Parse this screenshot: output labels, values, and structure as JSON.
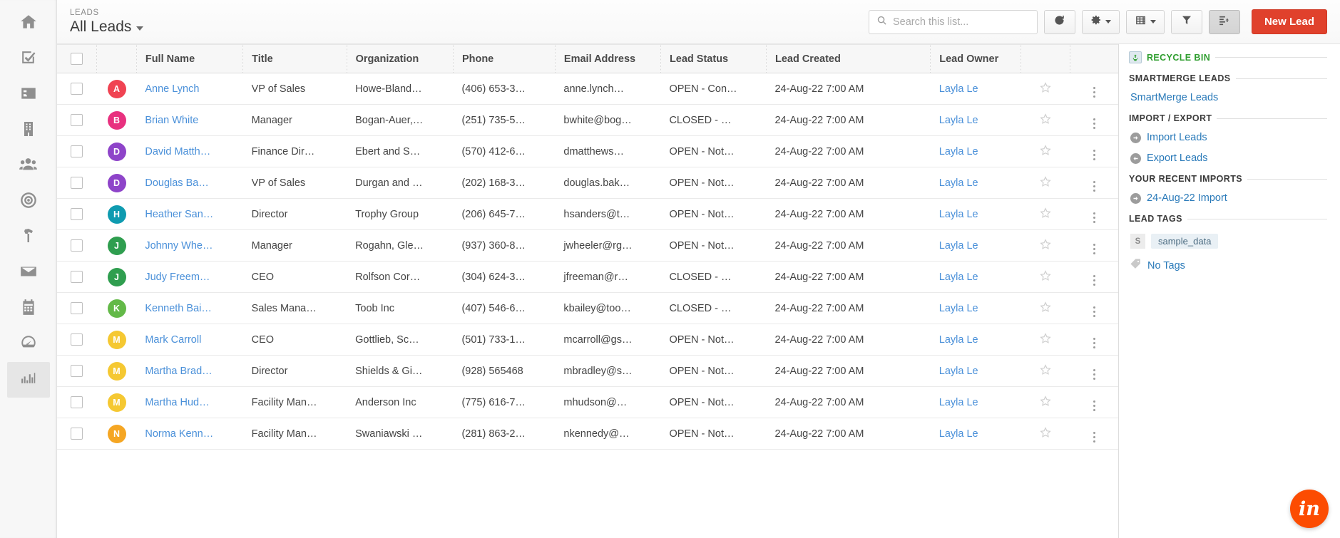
{
  "nav": {
    "items": [
      {
        "name": "home",
        "icon": "home-icon"
      },
      {
        "name": "tasks",
        "icon": "task-check-icon"
      },
      {
        "name": "contacts",
        "icon": "contact-card-icon"
      },
      {
        "name": "companies",
        "icon": "building-icon"
      },
      {
        "name": "leads",
        "icon": "users-icon"
      },
      {
        "name": "targets",
        "icon": "target-icon"
      },
      {
        "name": "projects",
        "icon": "hammer-icon"
      },
      {
        "name": "mail",
        "icon": "envelope-icon"
      },
      {
        "name": "calendar",
        "icon": "calendar-icon"
      },
      {
        "name": "dashboard",
        "icon": "gauge-icon"
      },
      {
        "name": "reports",
        "icon": "bar-chart-icon"
      }
    ],
    "active_index": 10
  },
  "header": {
    "eyebrow": "LEADS",
    "title": "All Leads",
    "search_placeholder": "Search this list...",
    "search_value": "",
    "refresh_label": "",
    "settings_label": "",
    "columns_label": "",
    "filter_label": "",
    "sort_label": "",
    "new_lead_label": "New Lead"
  },
  "table": {
    "columns": [
      "Full Name",
      "Title",
      "Organization",
      "Phone",
      "Email Address",
      "Lead Status",
      "Lead Created",
      "Lead Owner"
    ],
    "rows": [
      {
        "initial": "A",
        "color": "#f04352",
        "name": "Anne Lynch",
        "title": "VP of Sales",
        "org": "Howe-Bland…",
        "phone": "(406) 653-3…",
        "email": "anne.lynch…",
        "status": "OPEN - Con…",
        "created": "24-Aug-22 7:00 AM",
        "owner": "Layla Le"
      },
      {
        "initial": "B",
        "color": "#e8317f",
        "name": "Brian White",
        "title": "Manager",
        "org": "Bogan-Auer,…",
        "phone": "(251) 735-5…",
        "email": "bwhite@bog…",
        "status": "CLOSED - …",
        "created": "24-Aug-22 7:00 AM",
        "owner": "Layla Le"
      },
      {
        "initial": "D",
        "color": "#8e44c9",
        "name": "David Matth…",
        "title": "Finance Dir…",
        "org": "Ebert and S…",
        "phone": "(570) 412-6…",
        "email": "dmatthews…",
        "status": "OPEN - Not…",
        "created": "24-Aug-22 7:00 AM",
        "owner": "Layla Le"
      },
      {
        "initial": "D",
        "color": "#8e44c9",
        "name": "Douglas Ba…",
        "title": "VP of Sales",
        "org": "Durgan and …",
        "phone": "(202) 168-3…",
        "email": "douglas.bak…",
        "status": "OPEN - Not…",
        "created": "24-Aug-22 7:00 AM",
        "owner": "Layla Le"
      },
      {
        "initial": "H",
        "color": "#0f9bb0",
        "name": "Heather San…",
        "title": "Director",
        "org": "Trophy Group",
        "phone": "(206) 645-7…",
        "email": "hsanders@t…",
        "status": "OPEN - Not…",
        "created": "24-Aug-22 7:00 AM",
        "owner": "Layla Le"
      },
      {
        "initial": "J",
        "color": "#2f9e4f",
        "name": "Johnny Whe…",
        "title": "Manager",
        "org": "Rogahn, Gle…",
        "phone": "(937) 360-8…",
        "email": "jwheeler@rg…",
        "status": "OPEN - Not…",
        "created": "24-Aug-22 7:00 AM",
        "owner": "Layla Le"
      },
      {
        "initial": "J",
        "color": "#2f9e4f",
        "name": "Judy Freem…",
        "title": "CEO",
        "org": "Rolfson Cor…",
        "phone": "(304) 624-3…",
        "email": "jfreeman@r…",
        "status": "CLOSED - …",
        "created": "24-Aug-22 7:00 AM",
        "owner": "Layla Le"
      },
      {
        "initial": "K",
        "color": "#63b948",
        "name": "Kenneth Bai…",
        "title": "Sales Mana…",
        "org": "Toob Inc",
        "phone": "(407) 546-6…",
        "email": "kbailey@too…",
        "status": "CLOSED - …",
        "created": "24-Aug-22 7:00 AM",
        "owner": "Layla Le"
      },
      {
        "initial": "M",
        "color": "#f5c832",
        "name": "Mark Carroll",
        "title": "CEO",
        "org": "Gottlieb, Sc…",
        "phone": "(501) 733-1…",
        "email": "mcarroll@gs…",
        "status": "OPEN - Not…",
        "created": "24-Aug-22 7:00 AM",
        "owner": "Layla Le"
      },
      {
        "initial": "M",
        "color": "#f5c832",
        "name": "Martha Brad…",
        "title": "Director",
        "org": "Shields & Gi…",
        "phone": "(928) 565468",
        "email": "mbradley@s…",
        "status": "OPEN - Not…",
        "created": "24-Aug-22 7:00 AM",
        "owner": "Layla Le"
      },
      {
        "initial": "M",
        "color": "#f5c832",
        "name": "Martha Hud…",
        "title": "Facility Man…",
        "org": "Anderson Inc",
        "phone": "(775) 616-7…",
        "email": "mhudson@…",
        "status": "OPEN - Not…",
        "created": "24-Aug-22 7:00 AM",
        "owner": "Layla Le"
      },
      {
        "initial": "N",
        "color": "#f5a623",
        "name": "Norma Kenn…",
        "title": "Facility Man…",
        "org": "Swaniawski …",
        "phone": "(281) 863-2…",
        "email": "nkennedy@…",
        "status": "OPEN - Not…",
        "created": "24-Aug-22 7:00 AM",
        "owner": "Layla Le"
      }
    ]
  },
  "side_panel": {
    "recycle_bin": "RECYCLE BIN",
    "sections": [
      {
        "heading": "SMARTMERGE LEADS",
        "links": [
          {
            "label": "SmartMerge Leads",
            "badge": false
          }
        ]
      },
      {
        "heading": "IMPORT / EXPORT",
        "links": [
          {
            "label": "Import Leads",
            "badge": true,
            "dir": "right"
          },
          {
            "label": "Export Leads",
            "badge": true,
            "dir": "left"
          }
        ]
      },
      {
        "heading": "YOUR RECENT IMPORTS",
        "links": [
          {
            "label": "24-Aug-22 Import",
            "badge": true,
            "dir": "right"
          }
        ]
      }
    ],
    "lead_tags_heading": "LEAD TAGS",
    "tag_letter": "S",
    "tag_name": "sample_data",
    "no_tags": "No Tags"
  },
  "chat": {
    "label": "in"
  }
}
